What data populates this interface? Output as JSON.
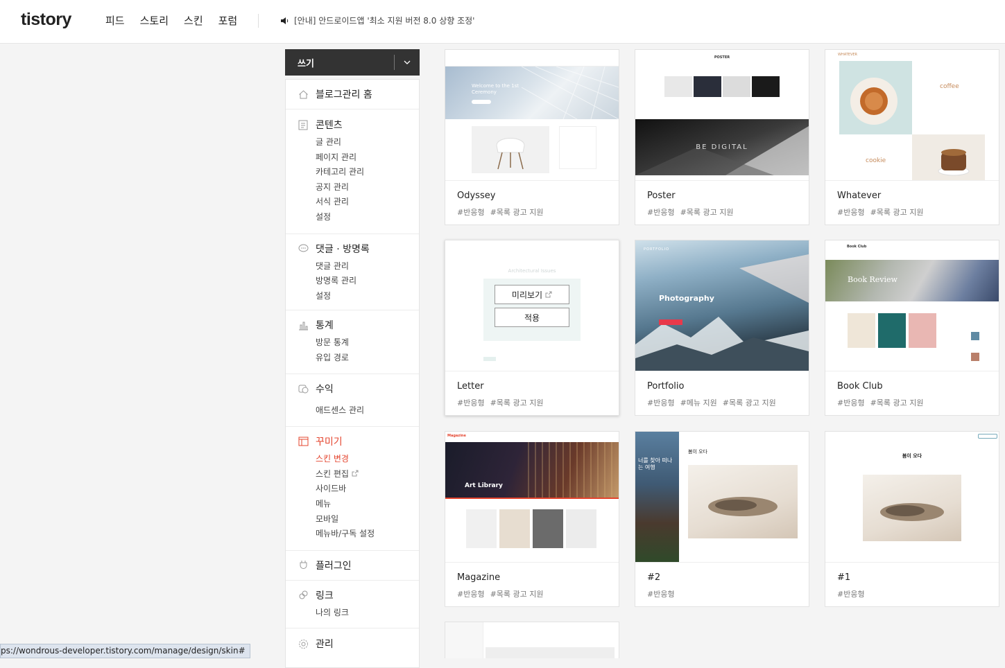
{
  "header": {
    "logo": "tistory",
    "nav": [
      "피드",
      "스토리",
      "스킨",
      "포럼"
    ],
    "notice": "[안내] 안드로이드앱 '최소 지원 버전 8.0 상향 조정'"
  },
  "sidebar": {
    "write_label": "쓰기",
    "sections": [
      {
        "title": "블로그관리 홈",
        "icon": "home-icon",
        "items": []
      },
      {
        "title": "콘텐츠",
        "icon": "document-icon",
        "items": [
          "글 관리",
          "페이지 관리",
          "카테고리 관리",
          "공지 관리",
          "서식 관리",
          "설정"
        ]
      },
      {
        "title": "댓글 · 방명록",
        "icon": "comment-icon",
        "items": [
          "댓글 관리",
          "방명록 관리",
          "설정"
        ]
      },
      {
        "title": "통계",
        "icon": "bar-chart-icon",
        "items": [
          "방문 통계",
          "유입 경로"
        ]
      },
      {
        "title": "수익",
        "icon": "revenue-icon",
        "items": [
          "애드센스 관리"
        ]
      },
      {
        "title": "꾸미기",
        "icon": "layout-icon",
        "items": [
          "스킨 변경",
          "스킨 편집",
          "사이드바",
          "메뉴",
          "모바일",
          "메뉴바/구독 설정"
        ]
      },
      {
        "title": "플러그인",
        "icon": "plug-icon",
        "items": []
      },
      {
        "title": "링크",
        "icon": "link-icon",
        "items": [
          "나의 링크"
        ]
      },
      {
        "title": "관리",
        "icon": "gear-icon",
        "items": []
      }
    ]
  },
  "skins": [
    {
      "name": "Odyssey",
      "tags": [
        "#반응형",
        "#목록 광고 지원"
      ],
      "thumb_text": "Welcome to the 1st Ceremony"
    },
    {
      "name": "Poster",
      "tags": [
        "#반응형",
        "#목록 광고 지원"
      ],
      "thumb_text": "BE DIGITAL",
      "thumb_heading": "POSTER"
    },
    {
      "name": "Whatever",
      "tags": [
        "#반응형",
        "#목록 광고 지원"
      ],
      "thumb_text": "coffee",
      "thumb_text2": "cookie",
      "thumb_heading": "WHATEVER"
    },
    {
      "name": "Letter",
      "tags": [
        "#반응형",
        "#목록 광고 지원"
      ],
      "preview_label": "미리보기",
      "apply_label": "적용",
      "thumb_text": "Architectural Issues"
    },
    {
      "name": "Portfolio",
      "tags": [
        "#반응형",
        "#메뉴 지원",
        "#목록 광고 지원"
      ],
      "thumb_text": "Photography",
      "thumb_heading": "PORTFOLIO"
    },
    {
      "name": "Book Club",
      "tags": [
        "#반응형",
        "#목록 광고 지원"
      ],
      "thumb_text": "Book Review",
      "thumb_heading": "Book Club"
    },
    {
      "name": "Magazine",
      "tags": [
        "#반응형",
        "#목록 광고 지원"
      ],
      "thumb_text": "Art Library",
      "thumb_heading": "Magazine"
    },
    {
      "name": "#2",
      "tags": [
        "#반응형"
      ],
      "thumb_text": "봄이 오다",
      "thumb_side": "너를 찾아 떠나는 여행"
    },
    {
      "name": "#1",
      "tags": [
        "#반응형"
      ],
      "thumb_text": "봄이 오다"
    }
  ],
  "status_url": "ps://wondrous-developer.tistory.com/manage/design/skin#",
  "colors": {
    "accent": "#e4442e",
    "dark": "#333333"
  }
}
